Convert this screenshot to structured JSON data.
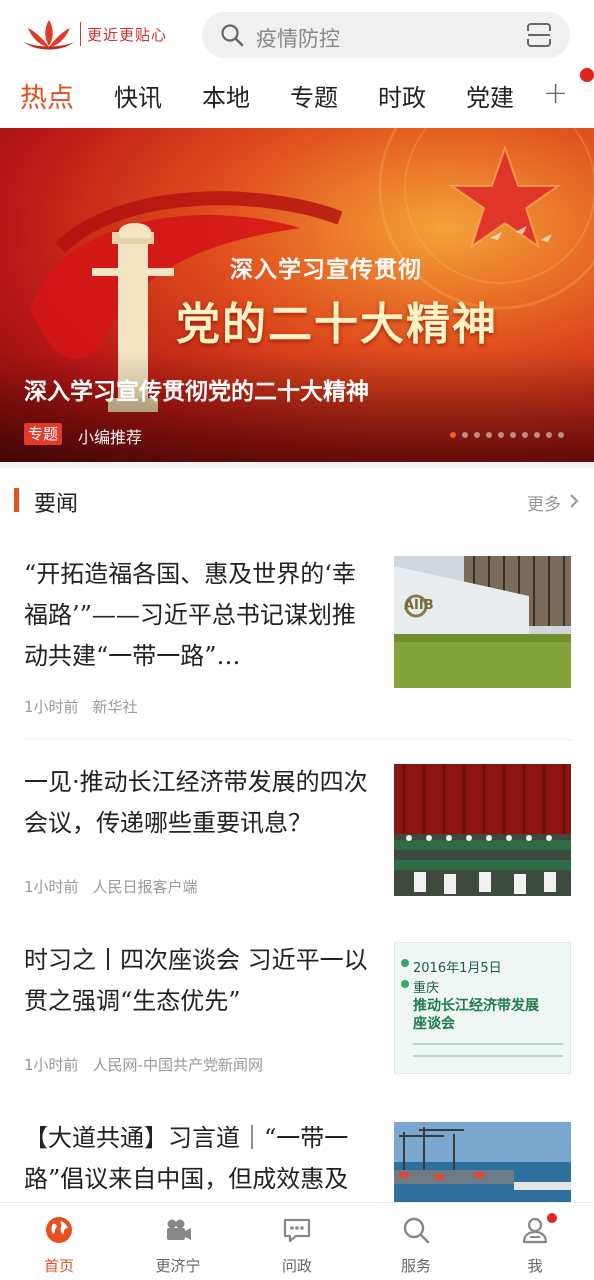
{
  "header": {
    "logo_text": "更近更贴心",
    "search_placeholder": "疫情防控"
  },
  "tabs": [
    {
      "label": "热点",
      "active": true
    },
    {
      "label": "快讯"
    },
    {
      "label": "本地"
    },
    {
      "label": "专题"
    },
    {
      "label": "时政"
    },
    {
      "label": "党建"
    }
  ],
  "tabs_more": "+",
  "banner": {
    "subtitle": "深入学习宣传贯彻",
    "headline": "党的二十大精神",
    "caption": "深入学习宣传贯彻党的二十大精神",
    "tag": "专题",
    "recommend": "小编推荐",
    "slide_count": 10,
    "active_slide": 1
  },
  "section": {
    "title": "要闻",
    "more": "更多"
  },
  "news": [
    {
      "title": "“开拓造福各国、惠及世界的‘幸福路’”——习近平总书记谋划推动共建“一带一路”…",
      "time": "1小时前",
      "source": "新华社",
      "thumb_text": "AIIB"
    },
    {
      "title": "一见·推动长江经济带发展的四次会议，传递哪些重要讯息？",
      "time": "1小时前",
      "source": "人民日报客户端"
    },
    {
      "title": "时习之丨四次座谈会 习近平一以贯之强调“生态优先”",
      "time": "1小时前",
      "source": "人民网-中国共产党新闻网",
      "thumb_date": "2016年1月5日",
      "thumb_city": "重庆",
      "thumb_headline_1": "推动长江经济带发展",
      "thumb_headline_2": "座谈会"
    },
    {
      "title": "【大道共通】习言道｜“一带一路”倡议来自中国，但成效惠及"
    }
  ],
  "bottom_nav": [
    {
      "label": "首页",
      "icon": "home-globe-icon",
      "active": true
    },
    {
      "label": "更济宁",
      "icon": "video-camera-icon"
    },
    {
      "label": "问政",
      "icon": "chat-bubble-icon"
    },
    {
      "label": "服务",
      "icon": "search-service-icon"
    },
    {
      "label": "我",
      "icon": "user-profile-icon",
      "badge": true
    }
  ],
  "colors": {
    "accent": "#e5501e",
    "badge": "#e0241c"
  }
}
